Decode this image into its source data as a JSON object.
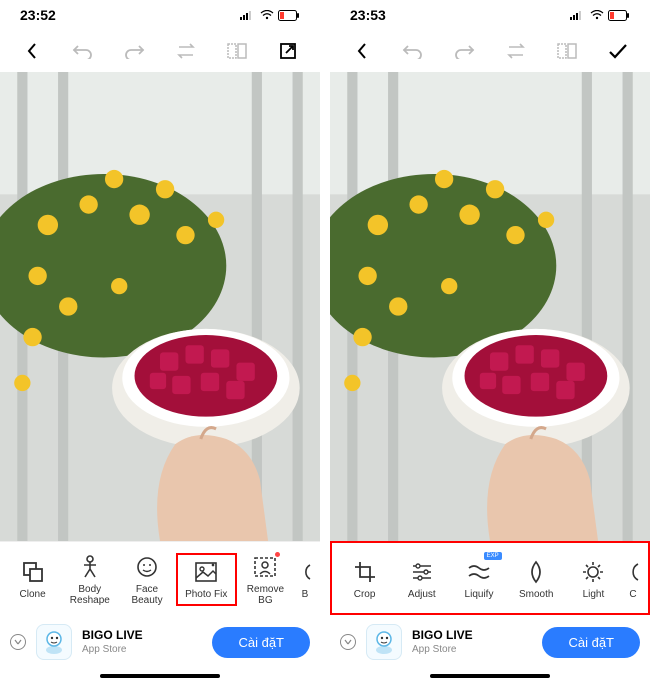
{
  "left": {
    "status_time": "23:52",
    "tools": [
      {
        "key": "clone",
        "label": "Clone"
      },
      {
        "key": "body-reshape",
        "label": "Body\nReshape"
      },
      {
        "key": "face-beauty",
        "label": "Face\nBeauty"
      },
      {
        "key": "photo-fix",
        "label": "Photo Fix",
        "highlighted": true
      },
      {
        "key": "remove-bg",
        "label": "Remove\nBG",
        "dot": true
      },
      {
        "key": "more",
        "label": "B"
      }
    ]
  },
  "right": {
    "status_time": "23:53",
    "tools": [
      {
        "key": "crop",
        "label": "Crop"
      },
      {
        "key": "adjust",
        "label": "Adjust"
      },
      {
        "key": "liquify",
        "label": "Liquify",
        "exp": "EXP"
      },
      {
        "key": "smooth",
        "label": "Smooth"
      },
      {
        "key": "light",
        "label": "Light"
      },
      {
        "key": "more",
        "label": "C"
      }
    ],
    "strip_highlighted": true
  },
  "ad": {
    "title": "BIGO LIVE",
    "subtitle": "App Store",
    "cta": "Cài đặT"
  },
  "badge_exp": "EXP"
}
